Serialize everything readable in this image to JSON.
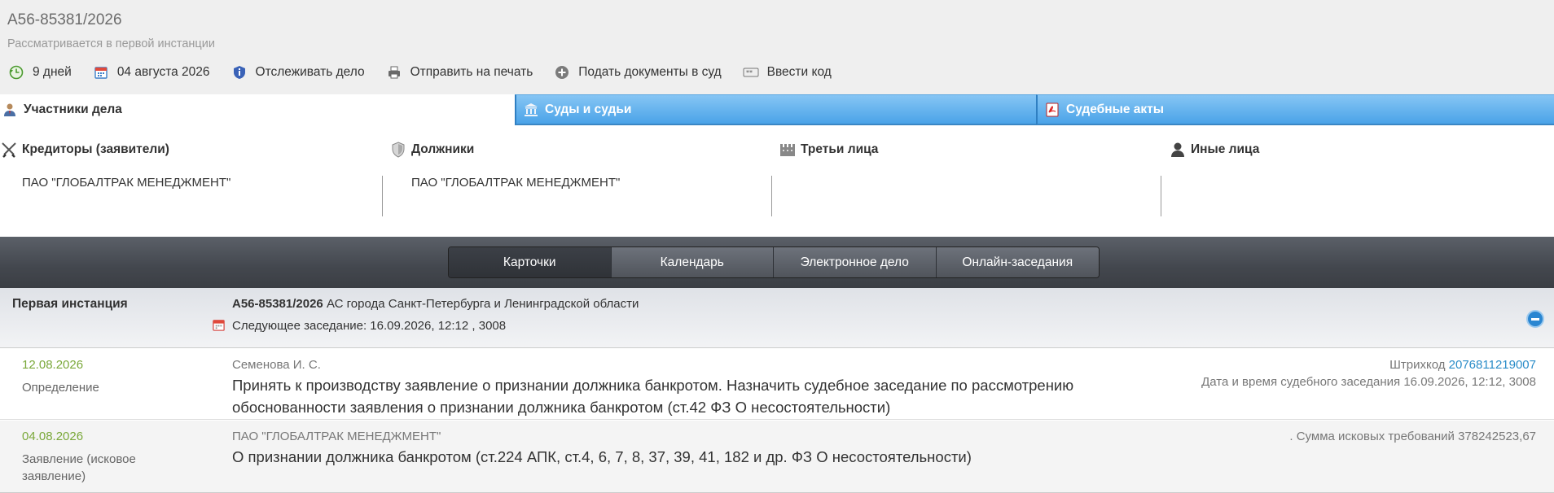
{
  "header": {
    "case_number": "А56-85381/2026",
    "status": "Рассматривается в первой инстанции",
    "actions": [
      {
        "label": "9 дней",
        "icon": "clock-back-icon"
      },
      {
        "label": "04 августа 2026",
        "icon": "calendar-icon"
      },
      {
        "label": "Отслеживать дело",
        "icon": "info-shield-icon"
      },
      {
        "label": "Отправить на печать",
        "icon": "printer-icon"
      },
      {
        "label": "Подать документы в суд",
        "icon": "plus-circle-icon"
      },
      {
        "label": "Ввести код",
        "icon": "keyboard-icon"
      }
    ]
  },
  "tabs": [
    {
      "label": "Участники дела",
      "icon": "person-icon",
      "active": true
    },
    {
      "label": "Суды и судьи",
      "icon": "courthouse-icon"
    },
    {
      "label": "Судебные акты",
      "icon": "pdf-document-icon"
    }
  ],
  "participants": [
    {
      "title": "Кредиторы (заявители)",
      "icon": "crossed-swords-icon",
      "names": [
        "ПАО \"ГЛОБАЛТРАК МЕНЕДЖМЕНТ\""
      ]
    },
    {
      "title": "Должники",
      "icon": "shield-icon",
      "names": [
        "ПАО \"ГЛОБАЛТРАК МЕНЕДЖМЕНТ\""
      ]
    },
    {
      "title": "Третьи лица",
      "icon": "building-icon",
      "names": []
    },
    {
      "title": "Иные лица",
      "icon": "user-silhouette-icon",
      "names": []
    }
  ],
  "view_tabs": [
    "Карточки",
    "Календарь",
    "Электронное дело",
    "Онлайн-заседания"
  ],
  "instance": {
    "label": "Первая инстанция",
    "case_number": "А56-85381/2026",
    "court": "АС города Санкт-Петербурга и Ленинградской области",
    "next_hearing": "Следующее заседание: 16.09.2026, 12:12 , 3008"
  },
  "documents": [
    {
      "date": "12.08.2026",
      "type": "Определение",
      "author": "Семенова И. С.",
      "text": "Принять к производству заявление о признании должника банкротом. Назначить судебное заседание по рассмотрению обоснованности заявления о признании должника банкротом (ст.42 ФЗ О несостоятельности)",
      "barcode_label": "Штрихкод",
      "barcode": "2076811219007",
      "hearing": "Дата и время судебного заседания 16.09.2026, 12:12, 3008"
    },
    {
      "date": "04.08.2026",
      "type": "Заявление (исковое заявление)",
      "author": "ПАО \"ГЛОБАЛТРАК МЕНЕДЖМЕНТ\"",
      "text": "О признании должника банкротом (ст.224 АПК, ст.4, 6, 7, 8, 37, 39, 41, 182 и др. ФЗ О несостоятельности)",
      "claim": ". Сумма исковых требований 378242523,67"
    }
  ]
}
